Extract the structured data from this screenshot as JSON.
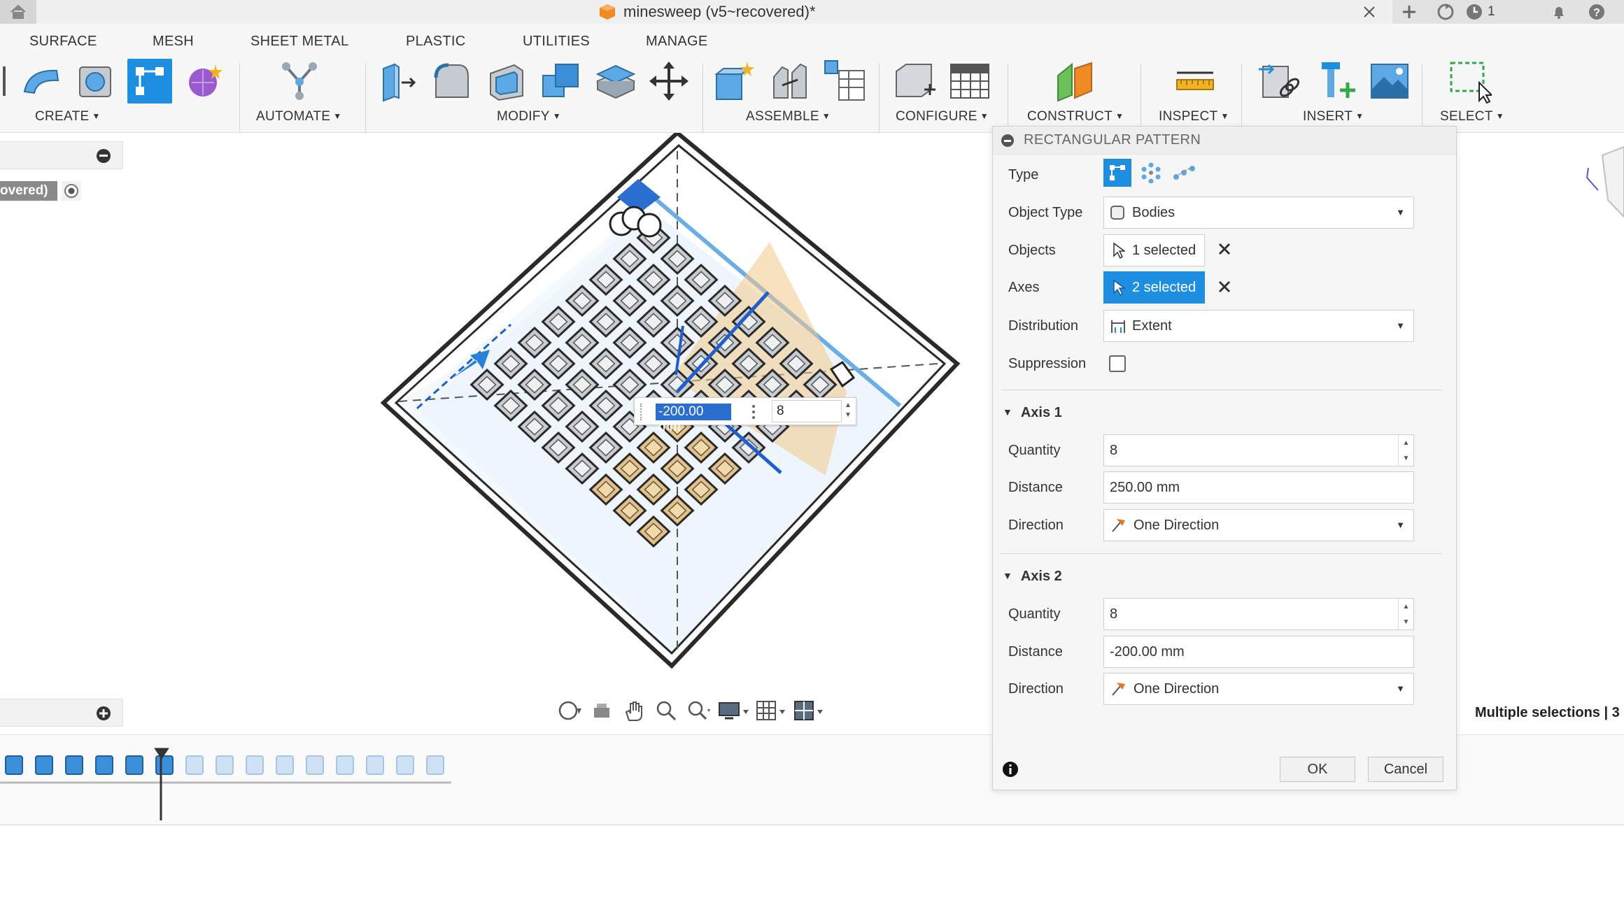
{
  "window": {
    "title": "minesweep (v5~recovered)*",
    "notification_count": "1"
  },
  "ribbon": {
    "tabs": [
      "SURFACE",
      "MESH",
      "SHEET METAL",
      "PLASTIC",
      "UTILITIES",
      "MANAGE"
    ],
    "groups": [
      "CREATE",
      "AUTOMATE",
      "MODIFY",
      "ASSEMBLE",
      "CONFIGURE",
      "CONSTRUCT",
      "INSPECT",
      "INSERT",
      "SELECT"
    ]
  },
  "browser": {
    "item_label": "overed)"
  },
  "viewport": {
    "dim_value": "-200.00 mm",
    "dim_count": "8"
  },
  "status": {
    "multiple_selections": "Multiple selections | 3"
  },
  "dialog": {
    "title": "RECTANGULAR PATTERN",
    "type_label": "Type",
    "object_type_label": "Object Type",
    "object_type_value": "Bodies",
    "objects_label": "Objects",
    "objects_value": "1 selected",
    "axes_label": "Axes",
    "axes_value": "2 selected",
    "distribution_label": "Distribution",
    "distribution_value": "Extent",
    "suppression_label": "Suppression",
    "axis1": {
      "header": "Axis 1",
      "quantity_label": "Quantity",
      "quantity": "8",
      "distance_label": "Distance",
      "distance": "250.00 mm",
      "direction_label": "Direction",
      "direction": "One Direction"
    },
    "axis2": {
      "header": "Axis 2",
      "quantity_label": "Quantity",
      "quantity": "8",
      "distance_label": "Distance",
      "distance": "-200.00 mm",
      "direction_label": "Direction",
      "direction": "One Direction"
    },
    "ok_label": "OK",
    "cancel_label": "Cancel"
  },
  "colors": {
    "accent": "#1e8fe0",
    "selection_blue": "#2a6fd0",
    "preview_orange": "#e8b86a"
  }
}
